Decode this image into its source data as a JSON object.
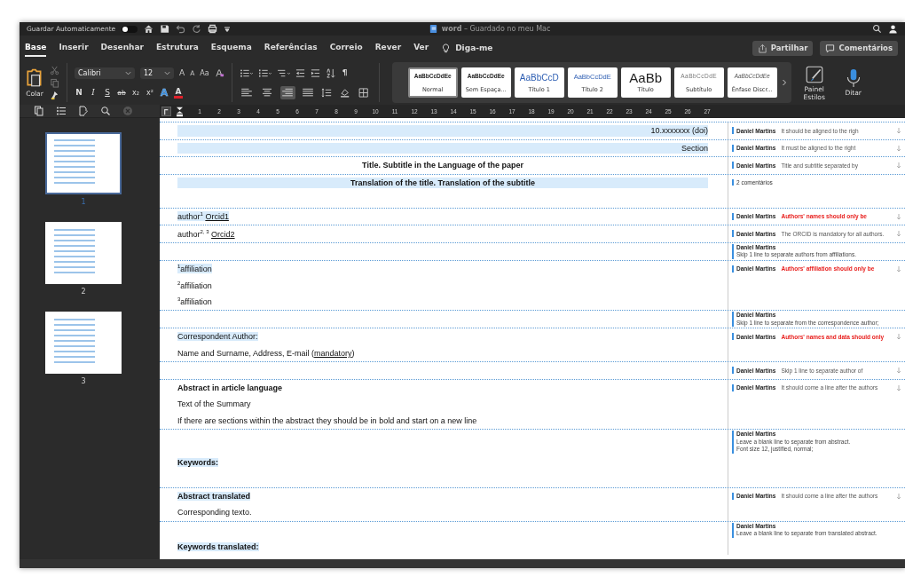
{
  "title_bar": {
    "autosave_label": "Guardar Automaticamente",
    "autosave_on": false,
    "title": "**word** – Guardado no meu Mac"
  },
  "ribbon_tabs": [
    {
      "label": "Base",
      "selected": true
    },
    {
      "label": "Inserir",
      "selected": false
    },
    {
      "label": "Desenhar",
      "selected": false
    },
    {
      "label": "Estrutura",
      "selected": false
    },
    {
      "label": "Esquema",
      "selected": false
    },
    {
      "label": "Referências",
      "selected": false
    },
    {
      "label": "Correio",
      "selected": false
    },
    {
      "label": "Rever",
      "selected": false
    },
    {
      "label": "Ver",
      "selected": false
    }
  ],
  "tell_me": "Diga-me",
  "share_button": "Partilhar",
  "comments_button": "Comentários",
  "ribbon": {
    "paste_label": "Colar",
    "font_name": "Calibri",
    "font_size": "12",
    "font_buttons": [
      {
        "label": "A",
        "kind": "grow"
      },
      {
        "label": "A",
        "kind": "shrink"
      },
      {
        "label": "Aa",
        "kind": "case"
      }
    ],
    "format_buttons": [
      {
        "label": "N",
        "kind": "bold"
      },
      {
        "label": "I",
        "kind": "italic"
      },
      {
        "label": "S",
        "kind": "underline"
      },
      {
        "label": "ab",
        "kind": "strike"
      },
      {
        "label": "x₂",
        "kind": "subscript"
      },
      {
        "label": "x²",
        "kind": "superscript"
      },
      {
        "label": "A",
        "kind": "text-effects"
      },
      {
        "label": "A",
        "kind": "font-color"
      }
    ],
    "alignment": [
      {
        "kind": "left",
        "selected": false
      },
      {
        "kind": "center",
        "selected": false
      },
      {
        "kind": "right",
        "selected": true
      },
      {
        "kind": "justify",
        "selected": false
      }
    ],
    "pilcrow": "¶",
    "styles": [
      {
        "sample": "AaBbCcDdEe",
        "name": "Normal",
        "kind": "normal",
        "selected": true
      },
      {
        "sample": "AaBbCcDdEe",
        "name": "Sem Espaça...",
        "kind": "normal",
        "selected": false
      },
      {
        "sample": "AaBbCcD",
        "name": "Título 1",
        "kind": "heading1",
        "selected": false
      },
      {
        "sample": "AaBbCcDdE",
        "name": "Título 2",
        "kind": "heading2",
        "selected": false
      },
      {
        "sample": "AaBb",
        "name": "Título",
        "kind": "title",
        "selected": false
      },
      {
        "sample": "AaBbCcDdE",
        "name": "Subtítulo",
        "kind": "subtitle",
        "selected": false
      },
      {
        "sample": "AaBbCcDdEe",
        "name": "Ênfase Discr...",
        "kind": "emphasis",
        "selected": false
      }
    ],
    "styles_pane_label": "Painel Estilos",
    "dictate_label": "Ditar"
  },
  "ruler_numbers": [
    "1",
    "2",
    "3",
    "4",
    "5",
    "6",
    "7",
    "8",
    "9",
    "10",
    "11",
    "12",
    "13",
    "14",
    "15",
    "16",
    "17",
    "18",
    "19",
    "20",
    "21",
    "22",
    "23",
    "24",
    "25",
    "26",
    "27"
  ],
  "pages": [
    {
      "number": "1",
      "selected": true
    },
    {
      "number": "2",
      "selected": false
    },
    {
      "number": "3",
      "selected": false
    }
  ],
  "paragraphs": [
    {
      "kind": "text",
      "text": "10.xxxxxxx (doi)",
      "right_aligned": true,
      "centered": false,
      "bold": false,
      "highlighted": true,
      "comment": {
        "kind": "inline",
        "author": "Daniel Martins",
        "text": "It should be aligned to the righ",
        "alert": false
      }
    },
    {
      "kind": "text",
      "text": "Section",
      "right_aligned": true,
      "centered": false,
      "bold": false,
      "highlighted": true,
      "comment": {
        "kind": "inline",
        "author": "Daniel Martins",
        "text": "It must be aligned to the right",
        "alert": false
      }
    },
    {
      "kind": "text",
      "text": "Title. Subtitle in the Language of the paper",
      "right_aligned": false,
      "centered": true,
      "bold": true,
      "highlighted": false,
      "comment": {
        "kind": "inline",
        "author": "Daniel Martins",
        "text": "Title and subtitle separated by",
        "alert": false
      }
    },
    {
      "kind": "text",
      "text": "Translation of the title. Translation of the subtitle",
      "right_aligned": false,
      "centered": true,
      "bold": true,
      "highlighted": true,
      "comment": {
        "kind": "count",
        "text": "2 comentários"
      }
    },
    {
      "kind": "empty"
    },
    {
      "kind": "text",
      "text": "author$^{1}$ ",
      "link": "Orcid1",
      "right_aligned": false,
      "centered": false,
      "bold": false,
      "highlighted": true,
      "comment": {
        "kind": "inline",
        "author": "Daniel Martins",
        "text": "Authors' names should only be",
        "alert": true
      }
    },
    {
      "kind": "text",
      "text": "author$^{2, 3}$ ",
      "link": "Orcid2",
      "right_aligned": false,
      "centered": false,
      "bold": false,
      "highlighted": false,
      "comment": {
        "kind": "inline",
        "author": "Daniel Martins",
        "text": "The ORCID is mandatory for all authors.",
        "alert": false
      }
    },
    {
      "kind": "empty",
      "comment": {
        "kind": "block",
        "author": "Daniel Martins",
        "lines": [
          "Skip 1 line to separate authors from affiliations."
        ]
      }
    },
    {
      "kind": "text",
      "text": "$^{1}$affiliation",
      "right_aligned": false,
      "centered": false,
      "bold": false,
      "highlighted": true,
      "comment": {
        "kind": "inline",
        "author": "Daniel Martins",
        "text": "Authors' affiliation should only be",
        "alert": true
      }
    },
    {
      "kind": "text",
      "text": "$^{2}$affiliation",
      "right_aligned": false,
      "centered": false,
      "bold": false,
      "highlighted": false
    },
    {
      "kind": "text",
      "text": "$^{3}$affiliation",
      "right_aligned": false,
      "centered": false,
      "bold": false,
      "highlighted": false
    },
    {
      "kind": "empty",
      "comment": {
        "kind": "block",
        "author": "Daniel Martins",
        "lines": [
          "Skip 1 line to separate from the correspondence author;"
        ]
      }
    },
    {
      "kind": "text",
      "text": "Correspondent Author:",
      "right_aligned": false,
      "centered": false,
      "bold": false,
      "highlighted": true,
      "comment": {
        "kind": "inline",
        "author": "Daniel Martins",
        "text": "Authors' names and data should only",
        "alert": true
      }
    },
    {
      "kind": "text",
      "text": "Name and Surname, Address, E-mail (",
      "link": "mandatory",
      "tail": ")",
      "right_aligned": false,
      "centered": false,
      "bold": false,
      "highlighted": false
    },
    {
      "kind": "empty",
      "comment": {
        "kind": "inline",
        "author": "Daniel Martins",
        "text": "Skip 1 line to separate author of",
        "alert": false
      }
    },
    {
      "kind": "text",
      "text": "**Abstract** in article language",
      "right_aligned": false,
      "centered": false,
      "bold": true,
      "highlighted": false,
      "comment": {
        "kind": "inline",
        "author": "Daniel Martins",
        "text": "It should come a line after the authors",
        "alert": false
      }
    },
    {
      "kind": "text",
      "text": "Text of the Summary",
      "right_aligned": false,
      "centered": false,
      "bold": false,
      "highlighted": false
    },
    {
      "kind": "text",
      "text": "If there are sections within the abstract they should be in bold and start on a new line",
      "right_aligned": false,
      "centered": false,
      "bold": false,
      "highlighted": false
    },
    {
      "kind": "empty",
      "comment": {
        "kind": "block",
        "author": "Daniel Martins",
        "lines": [
          "Leave a blank line to separate from abstract.",
          "Font size 12, justified, normal;"
        ]
      }
    },
    {
      "kind": "text",
      "text": "Keywords:",
      "right_aligned": false,
      "centered": false,
      "bold": true,
      "highlighted": true
    },
    {
      "kind": "empty"
    },
    {
      "kind": "text",
      "text": "Abstract translated",
      "right_aligned": false,
      "centered": false,
      "bold": true,
      "highlighted": true,
      "comment": {
        "kind": "inline",
        "author": "Daniel Martins",
        "text": "It should come a line after the authors",
        "alert": false
      }
    },
    {
      "kind": "text",
      "text": "Corresponding texto.",
      "right_aligned": false,
      "centered": false,
      "bold": false,
      "highlighted": false
    },
    {
      "kind": "empty",
      "comment": {
        "kind": "block",
        "author": "Daniel Martins",
        "lines": [
          "Leave a blank line to separate from translated abstract."
        ]
      }
    },
    {
      "kind": "text",
      "text": "Keywords translated:",
      "right_aligned": false,
      "centered": false,
      "bold": true,
      "highlighted": true
    }
  ]
}
